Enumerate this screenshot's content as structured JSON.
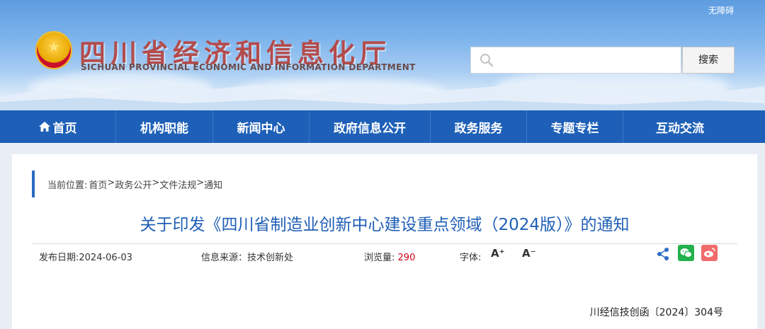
{
  "header": {
    "accessibility_link": "无障碍",
    "title_cn": "四川省经济和信息化厅",
    "title_en": "SICHUAN PROVINCIAL ECONOMIC AND INFORMATION DEPARTMENT",
    "emblem_icon": "national-emblem",
    "search": {
      "placeholder": "",
      "value": "",
      "button_label": "搜索"
    }
  },
  "nav": {
    "items": [
      {
        "label": "首页",
        "icon": "home-icon"
      },
      {
        "label": "机构职能"
      },
      {
        "label": "新闻中心"
      },
      {
        "label": "政府信息公开"
      },
      {
        "label": "政务服务"
      },
      {
        "label": "专题专栏"
      },
      {
        "label": "互动交流"
      }
    ]
  },
  "article": {
    "breadcrumb": {
      "prefix": "当前位置:",
      "items": [
        "首页",
        "政务公开",
        "文件法规",
        "通知"
      ],
      "separator": ">"
    },
    "title": "关于印发《四川省制造业创新中心建设重点领域（2024版）》的通知",
    "meta": {
      "date_label": "发布日期:",
      "date": "2024-06-03",
      "source_label": "信息来源：",
      "source": "技术创新处",
      "views_label": "浏览量:",
      "views": "290",
      "font_label": "字体:",
      "font_increase": "A⁺",
      "font_decrease": "A⁻"
    },
    "doc_number": "川经信技创函〔2024〕304号"
  },
  "colors": {
    "nav_bg": "#1e60b8",
    "title": "#1f5fb7",
    "accent_bar": "#2b6cc4",
    "views": "#d0021b"
  }
}
